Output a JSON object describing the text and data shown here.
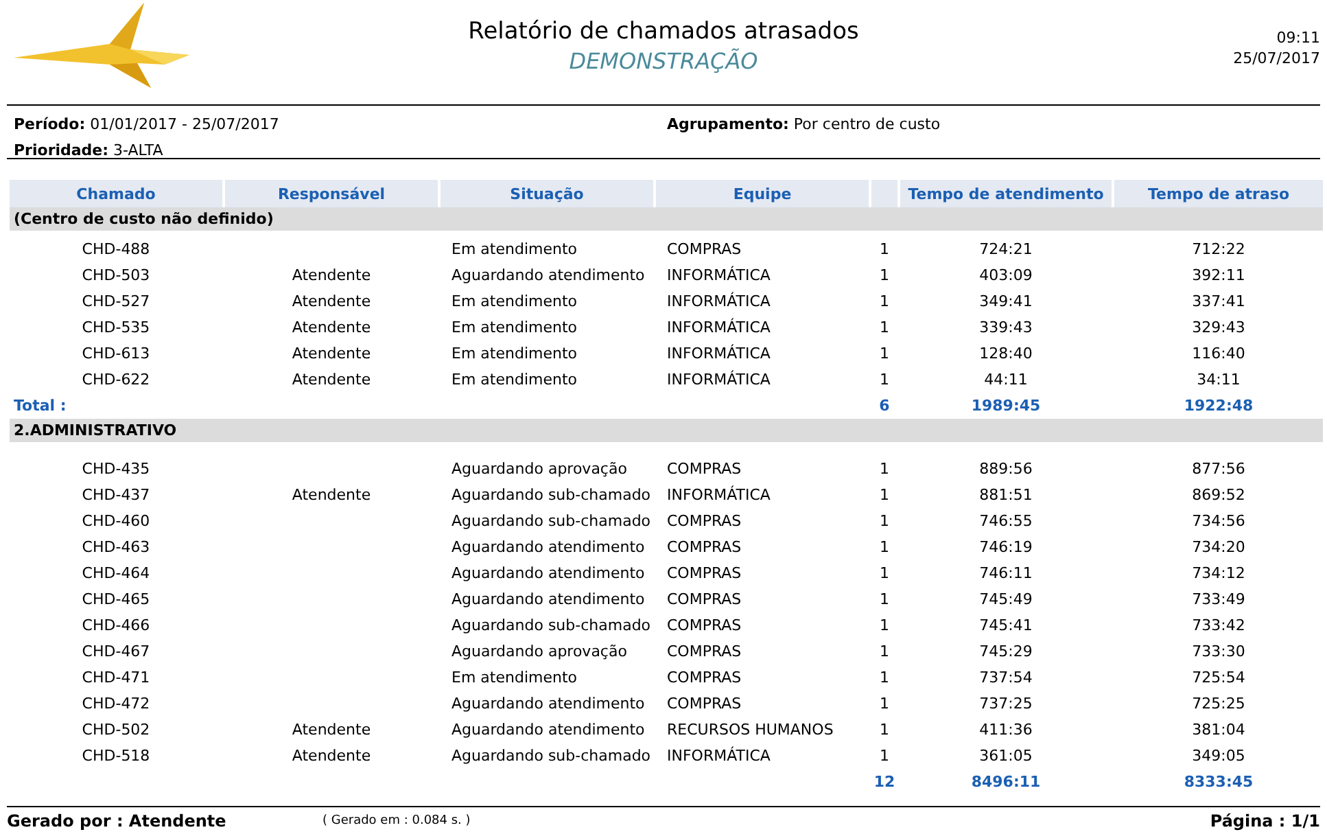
{
  "header": {
    "title": "Relatório de chamados atrasados",
    "subtitle": "DEMONSTRAÇÃO",
    "time": "09:11",
    "date": "25/07/2017"
  },
  "filters": [
    {
      "label": "Período:",
      "value": "01/01/2017 - 25/07/2017"
    },
    {
      "label": "Agrupamento:",
      "value": "Por centro de custo"
    },
    {
      "label": "Prioridade:",
      "value": "3-ALTA"
    }
  ],
  "columns": [
    "Chamado",
    "Responsável",
    "Situação",
    "Equipe",
    "",
    "Tempo de atendimento",
    "Tempo de atraso"
  ],
  "groups": [
    {
      "name": "(Centro de custo não definido)",
      "rows": [
        [
          "CHD-488",
          "",
          "Em atendimento",
          "COMPRAS",
          "1",
          "724:21",
          "712:22"
        ],
        [
          "CHD-503",
          "Atendente",
          "Aguardando atendimento",
          "INFORMÁTICA",
          "1",
          "403:09",
          "392:11"
        ],
        [
          "CHD-527",
          "Atendente",
          "Em atendimento",
          "INFORMÁTICA",
          "1",
          "349:41",
          "337:41"
        ],
        [
          "CHD-535",
          "Atendente",
          "Em atendimento",
          "INFORMÁTICA",
          "1",
          "339:43",
          "329:43"
        ],
        [
          "CHD-613",
          "Atendente",
          "Em atendimento",
          "INFORMÁTICA",
          "1",
          "128:40",
          "116:40"
        ],
        [
          "CHD-622",
          "Atendente",
          "Em atendimento",
          "INFORMÁTICA",
          "1",
          "44:11",
          "34:11"
        ]
      ],
      "total": {
        "label": "Total :",
        "count": "6",
        "tempo_atendimento": "1989:45",
        "tempo_atraso": "1922:48"
      }
    },
    {
      "name": "2.ADMINISTRATIVO",
      "rows": [
        [
          "CHD-435",
          "",
          "Aguardando aprovação",
          "COMPRAS",
          "1",
          "889:56",
          "877:56"
        ],
        [
          "CHD-437",
          "Atendente",
          "Aguardando sub-chamado",
          "INFORMÁTICA",
          "1",
          "881:51",
          "869:52"
        ],
        [
          "CHD-460",
          "",
          "Aguardando sub-chamado",
          "COMPRAS",
          "1",
          "746:55",
          "734:56"
        ],
        [
          "CHD-463",
          "",
          "Aguardando atendimento",
          "COMPRAS",
          "1",
          "746:19",
          "734:20"
        ],
        [
          "CHD-464",
          "",
          "Aguardando atendimento",
          "COMPRAS",
          "1",
          "746:11",
          "734:12"
        ],
        [
          "CHD-465",
          "",
          "Aguardando atendimento",
          "COMPRAS",
          "1",
          "745:49",
          "733:49"
        ],
        [
          "CHD-466",
          "",
          "Aguardando sub-chamado",
          "COMPRAS",
          "1",
          "745:41",
          "733:42"
        ],
        [
          "CHD-467",
          "",
          "Aguardando aprovação",
          "COMPRAS",
          "1",
          "745:29",
          "733:30"
        ],
        [
          "CHD-471",
          "",
          "Em atendimento",
          "COMPRAS",
          "1",
          "737:54",
          "725:54"
        ],
        [
          "CHD-472",
          "",
          "Aguardando atendimento",
          "COMPRAS",
          "1",
          "737:25",
          "725:25"
        ],
        [
          "CHD-502",
          "Atendente",
          "Aguardando atendimento",
          "RECURSOS HUMANOS",
          "1",
          "411:36",
          "381:04"
        ],
        [
          "CHD-518",
          "Atendente",
          "Aguardando sub-chamado",
          "INFORMÁTICA",
          "1",
          "361:05",
          "349:05"
        ]
      ],
      "total": {
        "count": "12",
        "tempo_atendimento": "8496:11",
        "tempo_atraso": "8333:45"
      }
    }
  ],
  "footer": {
    "generated_by": "Gerado por : Atendente",
    "generated_in": "( Gerado em : 0.084 s. )",
    "page": "Página : 1/1"
  }
}
